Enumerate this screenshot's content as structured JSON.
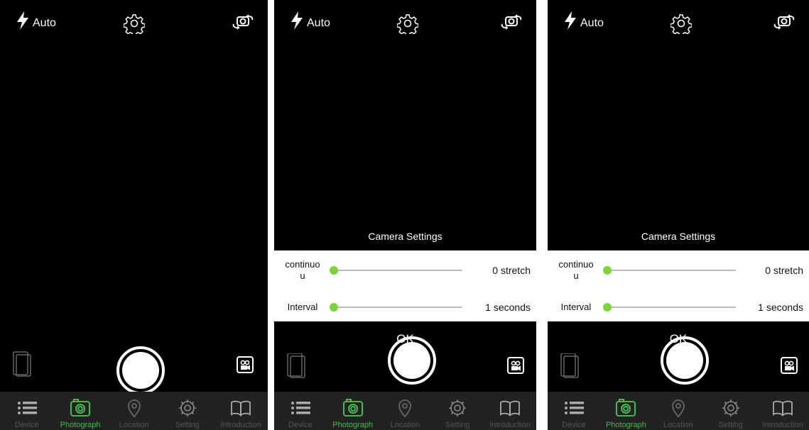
{
  "colors": {
    "accent": "#44b94f",
    "slider_thumb": "#7bd43a",
    "tabbar_bg": "#222222"
  },
  "flash": {
    "label": "Auto",
    "icon": "flash-icon"
  },
  "top_icons": {
    "settings": "gear-icon",
    "switch_camera": "switch-camera-icon"
  },
  "tabs": [
    {
      "label": "Device",
      "icon": "list-icon"
    },
    {
      "label": "Photograph",
      "icon": "camera-icon",
      "active": true
    },
    {
      "label": "Location",
      "icon": "location-pin-icon"
    },
    {
      "label": "Setting",
      "icon": "gear-icon"
    },
    {
      "label": "Introduction",
      "icon": "book-icon"
    }
  ],
  "camera_settings": {
    "title": "Camera Settings",
    "continuous": {
      "label": "continuo\nu",
      "value": 0,
      "value_label": "0 stretch"
    },
    "interval": {
      "label": "Interval",
      "value": 0,
      "value_label": "1 seconds"
    },
    "ok_label": "OK"
  }
}
